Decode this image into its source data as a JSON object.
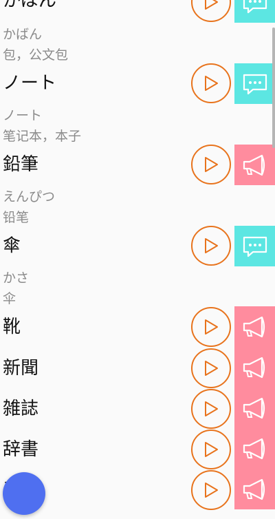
{
  "colors": {
    "accent_orange": "#e8731c",
    "speak_cyan": "#5ce6e2",
    "horn_pink": "#ff8c9e",
    "fab_blue": "#4f6ff0"
  },
  "entries": [
    {
      "word": "かばん",
      "reading": "かばん",
      "meaning": "包，公文包",
      "button_icon": "chat-bubble-icon",
      "button_color": "cyan"
    },
    {
      "word": "ノート",
      "reading": "ノート",
      "meaning": "笔记本，本子",
      "button_icon": "chat-bubble-icon",
      "button_color": "cyan"
    },
    {
      "word": "鉛筆",
      "reading": "えんぴつ",
      "meaning": "铅笔",
      "button_icon": "megaphone-icon",
      "button_color": "pink"
    },
    {
      "word": "傘",
      "reading": "かさ",
      "meaning": "伞",
      "button_icon": "chat-bubble-icon",
      "button_color": "cyan"
    },
    {
      "word": "靴",
      "reading": "",
      "meaning": "",
      "button_icon": "megaphone-icon",
      "button_color": "pink"
    },
    {
      "word": "新聞",
      "reading": "",
      "meaning": "",
      "button_icon": "megaphone-icon",
      "button_color": "pink"
    },
    {
      "word": "雑誌",
      "reading": "",
      "meaning": "",
      "button_icon": "megaphone-icon",
      "button_color": "pink"
    },
    {
      "word": "辞書",
      "reading": "",
      "meaning": "",
      "button_icon": "megaphone-icon",
      "button_color": "pink"
    },
    {
      "word": "手帳",
      "reading": "",
      "meaning": "",
      "button_icon": "megaphone-icon",
      "button_color": "pink"
    }
  ],
  "icons": {
    "play": "play-triangle-icon",
    "fab": "floating-action-button"
  }
}
